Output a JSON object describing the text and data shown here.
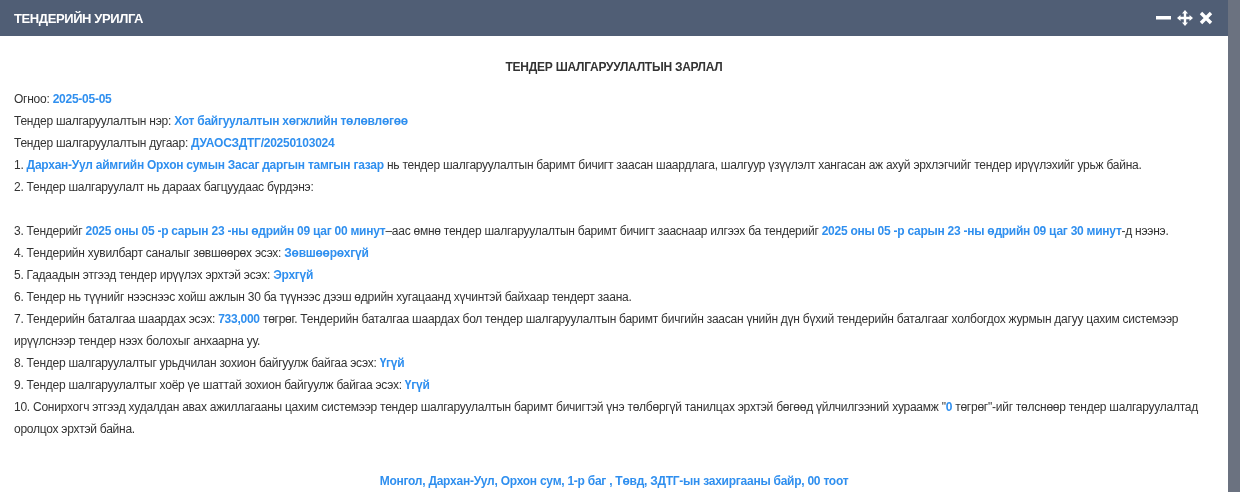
{
  "window": {
    "title": "ТЕНДЕРИЙН УРИЛГА"
  },
  "heading": "ТЕНДЕР ШАЛГАРУУЛАЛТЫН ЗАРЛАЛ",
  "fields": [
    {
      "label": "Огноо:",
      "value": "2025-05-05"
    },
    {
      "label": "Тендер шалгаруулалтын нэр:",
      "value": "Хот байгуулалтын хөгжлийн төлөвлөгөө"
    },
    {
      "label": "Тендер шалгаруулалтын дугаар:",
      "value": "ДУАОСЗДТГ/20250103024"
    }
  ],
  "items": [
    "1. **Дархан-Уул аймгийн Орхон сумын Засаг даргын тамгын газар** нь тендер шалгаруулалтын баримт бичигт заасан шаардлага, шалгуур үзүүлэлт хангасан аж ахуй эрхлэгчийг тендер ирүүлэхийг урьж байна.",
    "2. Тендер шалгаруулалт нь дараах багцуудаас бүрдэнэ:",
    "3. Тендерийг **2025 оны 05 -р сарын 23 -ны өдрийн 09 цаг 00 минут**–аас өмнө тендер шалгаруулалтын баримт бичигт зааснаар илгээх ба тендерийг **2025 оны 05 -р сарын 23 -ны өдрийн 09 цаг 30 минут**-д нээнэ.",
    "4. Тендерийн хувилбарт саналыг зөвшөөрөх эсэх: **Зөвшөөрөхгүй**",
    "5. Гадаадын этгээд тендер ирүүлэх эрхтэй эсэх: **Эрхгүй**",
    "6. Тендер нь түүнийг нээснээс хойш ажлын 30 ба түүнээс дээш өдрийн хугацаанд хүчинтэй байхаар тендерт заана.",
    "7. Тендерийн баталгаа шаардах эсэх: **733,000** төгрөг. Тендерийн баталгаа шаардах бол тендер шалгаруулалтын баримт бичгийн заасан үнийн дүн бүхий тендерийн баталгааг холбогдох журмын дагуу цахим системээр ирүүлснээр тендер нээх болохыг анхаарна уу.",
    "8. Тендер шалгаруулалтыг урьдчилан зохион байгуулж байгаа эсэх: **Үгүй**",
    "9. Тендер шалгаруулалтыг хоёр үе шаттай зохион байгуулж байгаа эсэх: **Үгүй**",
    "10. Сонирхогч этгээд худалдан авах ажиллагааны цахим системээр тендер шалгаруулалтын баримт бичигтэй үнэ төлбөргүй танилцах эрхтэй бөгөөд үйлчилгээний хураамж \"**0** төгрөг\"-ийг төлснөөр тендер шалгаруулалтад оролцох эрхтэй байна."
  ],
  "address": "Монгол, Дархан-Уул, Орхон сум, 1-р баг , Төвд, ЗДТГ-ын захиргааны байр, 00 тоот"
}
